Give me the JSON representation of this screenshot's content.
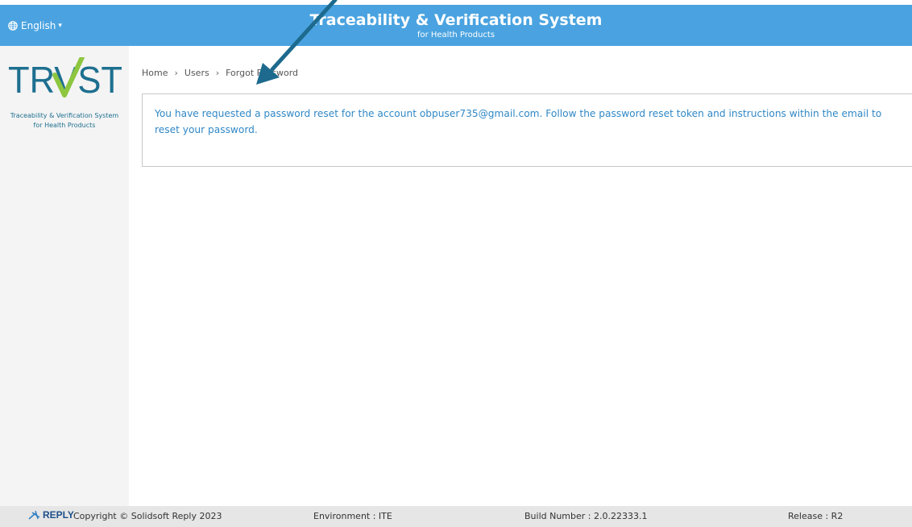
{
  "header": {
    "language": "English",
    "title": "Traceability & Verification System",
    "subtitle": "for Health Products"
  },
  "sidebar": {
    "logo_text": "TRVST",
    "tagline_line1": "Traceability & Verification System",
    "tagline_line2": "for Health Products"
  },
  "breadcrumb": {
    "items": [
      "Home",
      "Users",
      "Forgot Password"
    ]
  },
  "alert": {
    "message": "You have requested a password reset for the account obpuser735@gmail.com. Follow the password reset token and instructions within the email to reset your password."
  },
  "footer": {
    "brand": "REPLY",
    "copyright": "Copyright © Solidsoft Reply 2023",
    "environment": "Environment : ITE",
    "build_number": "Build Number : 2.0.22333.1",
    "release": "Release : R2"
  },
  "colors": {
    "header_bg": "#4aa3e0",
    "logo_teal": "#1d6f8f",
    "logo_green": "#8dc63f",
    "alert_text": "#3088c6",
    "annotation_arrow": "#1d6a8e"
  },
  "icons": {
    "language": "globe-icon",
    "dropdown": "caret-down-icon",
    "breadcrumb_separator": "chevron-right-icon",
    "annotation": "annotation-arrow-icon"
  }
}
